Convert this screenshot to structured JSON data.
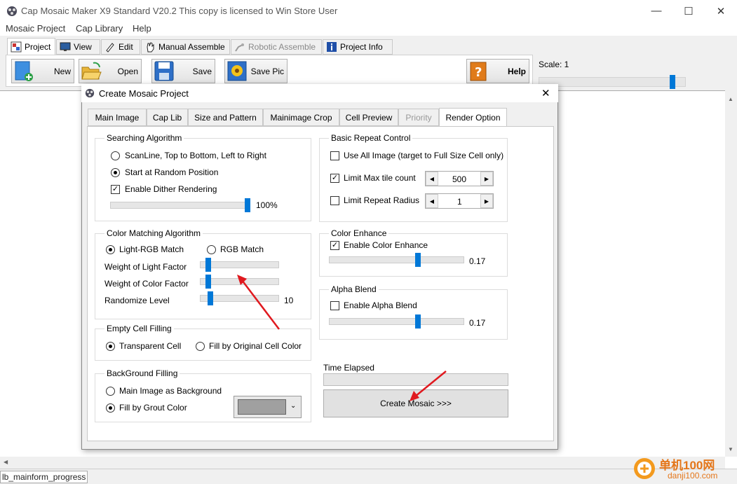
{
  "window": {
    "title": "Cap Mosaic Maker X9 Standard V20.2   This copy is licensed to Win Store User"
  },
  "menu": [
    "Mosaic Project",
    "Cap Library",
    "Help"
  ],
  "top_tabs": [
    "Project",
    "View",
    "Edit",
    "Manual Assemble",
    "Robotic Assemble",
    "Project Info"
  ],
  "toolbar": {
    "new": "New",
    "open": "Open",
    "save": "Save",
    "save_pic": "Save Pic",
    "help": "Help"
  },
  "scale": {
    "label": "Scale: 1",
    "level": 0.93
  },
  "status": {
    "text": "lb_mainform_progress"
  },
  "dialog": {
    "title": "Create Mosaic Project",
    "tabs": [
      "Main Image",
      "Cap Lib",
      "Size and Pattern",
      "Mainimage Crop",
      "Cell Preview",
      "Priority",
      "Render Option"
    ],
    "searching": {
      "title": "Searching Algorithm",
      "opt1": "ScanLine, Top to Bottom, Left to Right",
      "opt2": "Start at Random Position",
      "dither": "Enable Dither Rendering",
      "dither_value": "100%",
      "dither_level": 1.0
    },
    "color_matching": {
      "title": "Color Matching Algorithm",
      "opt1": "Light-RGB Match",
      "opt2": "RGB Match",
      "light_factor": "Weight of Light Factor",
      "color_factor": "Weight of Color Factor",
      "randomize": "Randomize Level",
      "randomize_value": "10"
    },
    "empty_cell": {
      "title": "Empty Cell Filling",
      "opt1": "Transparent Cell",
      "opt2": "Fill by Original Cell Color"
    },
    "background": {
      "title": "BackGround Filling",
      "opt1": "Main Image as Background",
      "opt2": "Fill by Grout Color",
      "grout_color": "#a0a0a0"
    },
    "repeat": {
      "title": "Basic Repeat Control",
      "use_all": "Use All Image (target to Full Size Cell only)",
      "limit_max": "Limit Max tile count",
      "limit_max_value": "500",
      "limit_radius": "Limit Repeat Radius",
      "limit_radius_value": "1"
    },
    "color_enhance": {
      "title": "Color Enhance",
      "enable": "Enable Color Enhance",
      "value": "0.17"
    },
    "alpha_blend": {
      "title": "Alpha Blend",
      "enable": "Enable Alpha Blend",
      "value": "0.17"
    },
    "time_elapsed": "Time Elapsed",
    "create_button": "Create Mosaic >>>"
  },
  "watermark": {
    "text": "单机100网",
    "url": "danji100.com"
  }
}
